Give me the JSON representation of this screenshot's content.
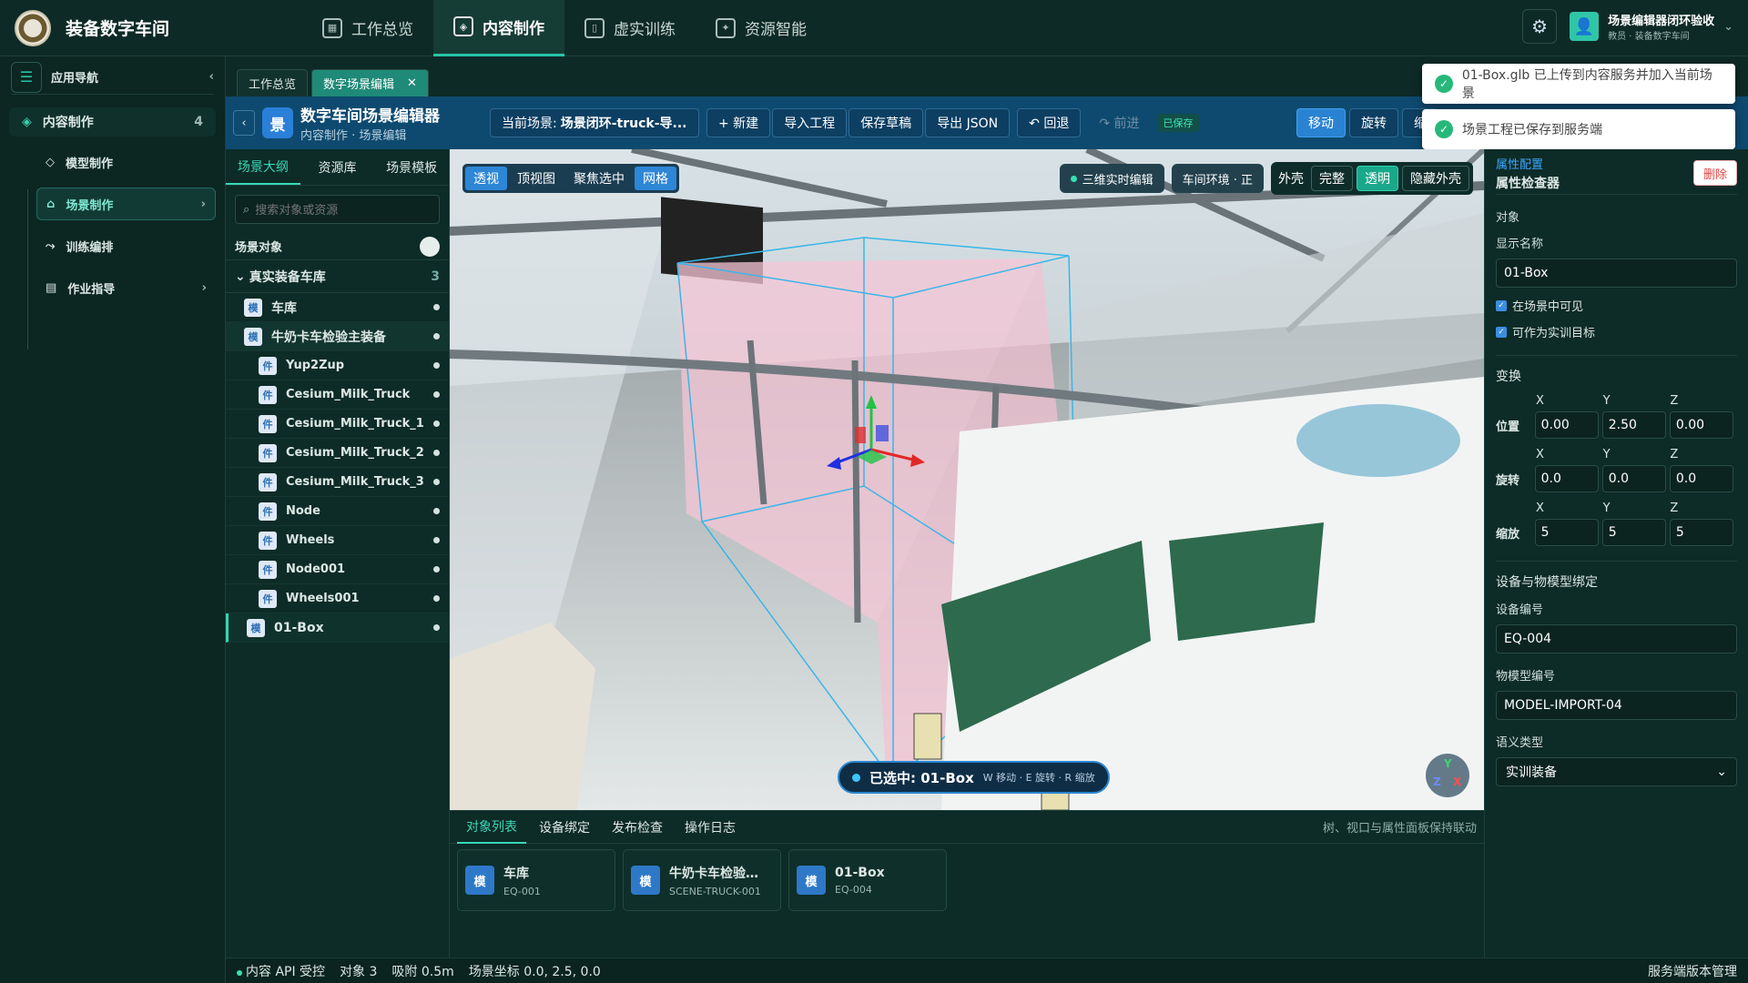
{
  "app": {
    "title": "装备数字车间"
  },
  "nav": [
    {
      "label": "工作总览",
      "icon": "grid-icon",
      "active": false
    },
    {
      "label": "内容制作",
      "icon": "cube-icon",
      "active": true
    },
    {
      "label": "虚实训练",
      "icon": "book-icon",
      "active": false
    },
    {
      "label": "资源智能",
      "icon": "brain-icon",
      "active": false
    }
  ],
  "user": {
    "name": "场景编辑器闭环验收",
    "role": "教员 · 装备数字车间"
  },
  "sidebar": {
    "title": "应用导航",
    "group": {
      "label": "内容制作",
      "count": "4"
    },
    "items": [
      {
        "label": "模型制作",
        "active": false,
        "chev": ""
      },
      {
        "label": "场景制作",
        "active": true,
        "chev": "›"
      },
      {
        "label": "训练编排",
        "active": false,
        "chev": ""
      },
      {
        "label": "作业指导",
        "active": false,
        "chev": "›"
      }
    ]
  },
  "pagetabs": [
    {
      "label": "工作总览",
      "active": false
    },
    {
      "label": "数字场景编辑",
      "active": true
    }
  ],
  "editor": {
    "logo": "景",
    "title": "数字车间场景编辑器",
    "subtitle": "内容制作 · 场景编辑",
    "scene_label": "当前场景:",
    "scene_name": "场景闭环-truck-导...",
    "new_btn": "+ 新建",
    "import_btn": "导入工程",
    "save_btn": "保存草稿",
    "export_btn": "导出 JSON",
    "undo_btn": "↶ 回退",
    "redo_btn": "↷ 前进",
    "saved_tag": "已保存",
    "move_btn": "移动",
    "rotate_btn": "旋转",
    "scale_btn": "缩"
  },
  "toasts": [
    "01-Box.glb 已上传到内容服务并加入当前场景",
    "场景工程已保存到服务端"
  ],
  "left": {
    "tabs": [
      "场景大纲",
      "资源库",
      "场景模板"
    ],
    "search_placeholder": "搜索对象或资源",
    "objects_label": "场景对象",
    "folder": {
      "label": "真实装备车库",
      "count": "3"
    },
    "nodes": [
      {
        "badge": "模",
        "label": "车库",
        "child": false,
        "sel": false
      },
      {
        "badge": "模",
        "label": "牛奶卡车检验主装备",
        "child": false,
        "sel": true
      },
      {
        "badge": "件",
        "label": "Yup2Zup",
        "child": true
      },
      {
        "badge": "件",
        "label": "Cesium_Milk_Truck",
        "child": true
      },
      {
        "badge": "件",
        "label": "Cesium_Milk_Truck_1",
        "child": true
      },
      {
        "badge": "件",
        "label": "Cesium_Milk_Truck_2",
        "child": true
      },
      {
        "badge": "件",
        "label": "Cesium_Milk_Truck_3",
        "child": true
      },
      {
        "badge": "件",
        "label": "Node",
        "child": true
      },
      {
        "badge": "件",
        "label": "Wheels",
        "child": true
      },
      {
        "badge": "件",
        "label": "Node001",
        "child": true
      },
      {
        "badge": "件",
        "label": "Wheels001",
        "child": true
      },
      {
        "badge": "模",
        "label": "01-Box",
        "child": false,
        "hl": true
      }
    ]
  },
  "viewport": {
    "views": [
      {
        "label": "透视",
        "on": true
      },
      {
        "label": "顶视图",
        "on": false
      },
      {
        "label": "聚焦选中",
        "on": false
      },
      {
        "label": "网格",
        "on": true
      }
    ],
    "live_chip": "三维实时编辑",
    "env_chip": "车间环境 · 正",
    "shell_label": "外壳",
    "shell_full": "完整",
    "shell_trans": "透明",
    "shell_hide": "隐藏外壳",
    "selected_label": "已选中:",
    "selected_name": "01-Box",
    "hint": "W 移动 · E 旋转 · R 缩放",
    "axis": {
      "y": "Y",
      "z": "Z",
      "x": "X"
    }
  },
  "bottom": {
    "tabs": [
      "对象列表",
      "设备绑定",
      "发布检查",
      "操作日志"
    ],
    "note": "树、视口与属性面板保持联动",
    "cards": [
      {
        "badge": "模",
        "title": "车库",
        "sub": "EQ-001"
      },
      {
        "badge": "模",
        "title": "牛奶卡车检验主...",
        "sub": "SCENE-TRUCK-001"
      },
      {
        "badge": "模",
        "title": "01-Box",
        "sub": "EQ-004"
      }
    ]
  },
  "props": {
    "kicker": "属性配置",
    "title": "属性检查器",
    "delete_btn": "删除",
    "object_section": "对象",
    "display_name_label": "显示名称",
    "display_name": "01-Box",
    "visible_label": "在场景中可见",
    "target_label": "可作为实训目标",
    "transform_section": "变换",
    "axes": [
      "X",
      "Y",
      "Z"
    ],
    "position_label": "位置",
    "position": [
      "0.00",
      "2.50",
      "0.00"
    ],
    "rotation_label": "旋转",
    "rotation": [
      "0.0",
      "0.0",
      "0.0"
    ],
    "scale_label": "缩放",
    "scale": [
      "5",
      "5",
      "5"
    ],
    "binding_section": "设备与物模型绑定",
    "device_label": "设备编号",
    "device": "EQ-004",
    "model_label": "物模型编号",
    "model": "MODEL-IMPORT-04",
    "semantic_label": "语义类型",
    "semantic": "实训装备"
  },
  "status": {
    "api": "内容 API 受控",
    "objects": "对象 3",
    "snap": "吸附 0.5m",
    "coords": "场景坐标 0.0, 2.5, 0.0",
    "right": "服务端版本管理"
  }
}
